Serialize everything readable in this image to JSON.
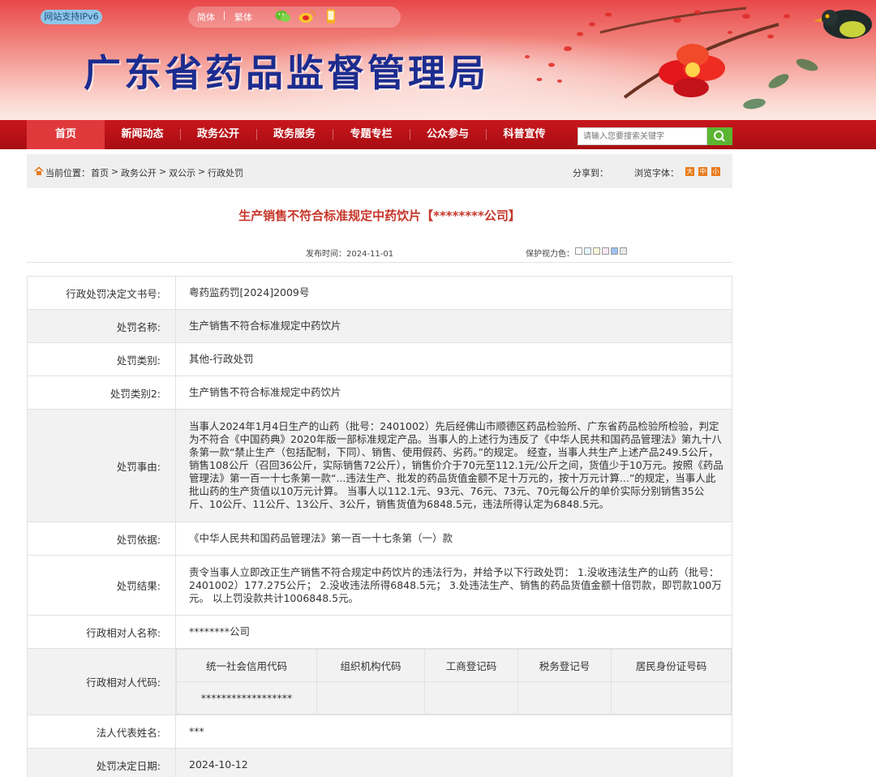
{
  "header": {
    "ipv6_badge": "网站支持IPv6",
    "lang_simplified": "简体",
    "lang_traditional": "繁体",
    "site_title": "广东省药品监督管理局"
  },
  "nav": {
    "items": [
      "首页",
      "新闻动态",
      "政务公开",
      "政务服务",
      "专题专栏",
      "公众参与",
      "科普宣传"
    ],
    "search_placeholder": "请输入您要搜索关键字"
  },
  "breadcrumb": {
    "label": "当前位置：",
    "items": [
      "首页",
      "政务公开",
      "双公示",
      "行政处罚"
    ],
    "share_label": "分享到：",
    "font_label": "浏览字体：",
    "font_sizes": [
      "大",
      "中",
      "小"
    ]
  },
  "article": {
    "title": "生产销售不符合标准规定中药饮片【********公司】",
    "publish_time": "发布时间：2024-11-01",
    "eye_care_label": "保护视力色：",
    "eye_care_colors": [
      "#ffffff",
      "#e3f4fb",
      "#f7f7d8",
      "#fbe6f4",
      "#9ec3f1",
      "#e9e9e9"
    ]
  },
  "record": {
    "doc_number_label": "行政处罚决定文书号:",
    "doc_number": "粤药监药罚[2024]2009号",
    "penalty_name_label": "处罚名称:",
    "penalty_name": "生产销售不符合标准规定中药饮片",
    "category_label": "处罚类别:",
    "category": "其他-行政处罚",
    "category2_label": "处罚类别2:",
    "category2": "生产销售不符合标准规定中药饮片",
    "reason_label": "处罚事由:",
    "reason": "当事人2024年1月4日生产的山药（批号：2401002）先后经佛山市顺德区药品检验所、广东省药品检验所检验，判定为不符合《中国药典》2020年版一部标准规定产品。当事人的上述行为违反了《中华人民共和国药品管理法》第九十八条第一款“禁止生产（包括配制，下同）、销售、使用假药、劣药。”的规定。 经查，当事人共生产上述产品249.5公斤，销售108公斤（召回36公斤，实际销售72公斤），销售价介于70元至112.1元/公斤之间，货值少于10万元。按照《药品管理法》第一百一十七条第一款“...违法生产、批发的药品货值金额不足十万元的，按十万元计算...”的规定，当事人此批山药的生产货值以10万元计算。 当事人以112.1元、93元、76元、73元、70元每公斤的单价实际分别销售35公斤、10公斤、11公斤、13公斤、3公斤，销售货值为6848.5元，违法所得认定为6848.5元。",
    "basis_label": "处罚依据:",
    "basis": "《中华人民共和国药品管理法》第一百一十七条第（一）款",
    "result_label": "处罚结果:",
    "result": "责令当事人立即改正生产销售不符合规定中药饮片的违法行为，并给予以下行政处罚： 1.没收违法生产的山药（批号：2401002）177.275公斤； 2.没收违法所得6848.5元； 3.处违法生产、销售的药品货值金额十倍罚款，即罚款100万元。 以上罚没款共计1006848.5元。",
    "party_name_label": "行政相对人名称:",
    "party_name": "********公司",
    "party_code_label": "行政相对人代码:",
    "code_headers": [
      "统一社会信用代码",
      "组织机构代码",
      "工商登记码",
      "税务登记号",
      "居民身份证号码"
    ],
    "code_values": [
      "******************",
      "",
      "",
      "",
      ""
    ],
    "legal_rep_label": "法人代表姓名:",
    "legal_rep": "***",
    "decision_date_label": "处罚决定日期:",
    "decision_date": "2024-10-12"
  }
}
